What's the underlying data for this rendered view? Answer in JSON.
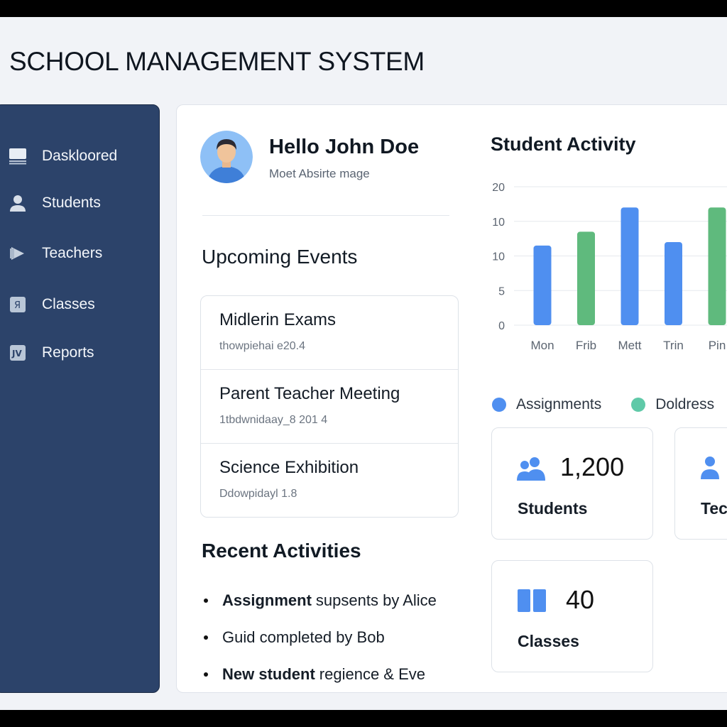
{
  "app": {
    "title": "SCHOOL MANAGEMENT SYSTEM"
  },
  "sidebar": {
    "items": [
      {
        "label": "Daskloored",
        "icon": "dashboard-icon"
      },
      {
        "label": "Students",
        "icon": "person-icon"
      },
      {
        "label": "Teachers",
        "icon": "teacher-icon"
      },
      {
        "label": "Classes",
        "icon": "classes-icon"
      },
      {
        "label": "Reports",
        "icon": "reports-icon"
      }
    ]
  },
  "profile": {
    "greeting": "Hello John Doe",
    "subtitle": "Moet  Absirte mage"
  },
  "events": {
    "title": "Upcoming Events",
    "items": [
      {
        "name": "Midlerin Exams",
        "date": "thowpiehai e20.4"
      },
      {
        "name": "Parent Teacher Meeting",
        "date": "1tbdwnidaay_8 201 4"
      },
      {
        "name": "Science Exhibition",
        "date": "Ddowpidayl 1.8"
      }
    ]
  },
  "activities": {
    "title": "Recent Activities",
    "items": [
      {
        "bold": "Assignment",
        "rest": "supsents by Alice"
      },
      {
        "bold": "",
        "rest": "Guid completed by Bob"
      },
      {
        "bold": "New student",
        "rest": "regience & Eve"
      }
    ]
  },
  "chart_data": {
    "type": "bar",
    "title": "Student Activity",
    "categories": [
      "Mon",
      "Frib",
      "Mett",
      "Trin",
      "Pin"
    ],
    "series": [
      {
        "name": "Assignments",
        "color": "#4f8ff0"
      },
      {
        "name": "Doldress",
        "color": "#5fba7d"
      }
    ],
    "values": [
      11.5,
      13.5,
      17,
      12,
      17
    ],
    "bar_colors": [
      "#4f8ff0",
      "#5fba7d",
      "#4f8ff0",
      "#4f8ff0",
      "#5fba7d"
    ],
    "y_tick_labels": [
      "0",
      "5",
      "10",
      "10",
      "20"
    ],
    "ylim": [
      0,
      20
    ],
    "grid": true,
    "legend": "bottom",
    "legend_dot_colors": [
      "#4f8ff0",
      "#5fc9a8"
    ]
  },
  "stats": {
    "students": {
      "value": "1,200",
      "label": "Students",
      "icon": "users-icon"
    },
    "teachers": {
      "label": "Tec",
      "icon": "person-icon"
    },
    "classes": {
      "value": "40",
      "label": "Classes",
      "icon": "book-icon"
    }
  },
  "colors": {
    "sidebar": "#2c436a",
    "accent": "#4f8ff0",
    "green": "#5fba7d"
  }
}
